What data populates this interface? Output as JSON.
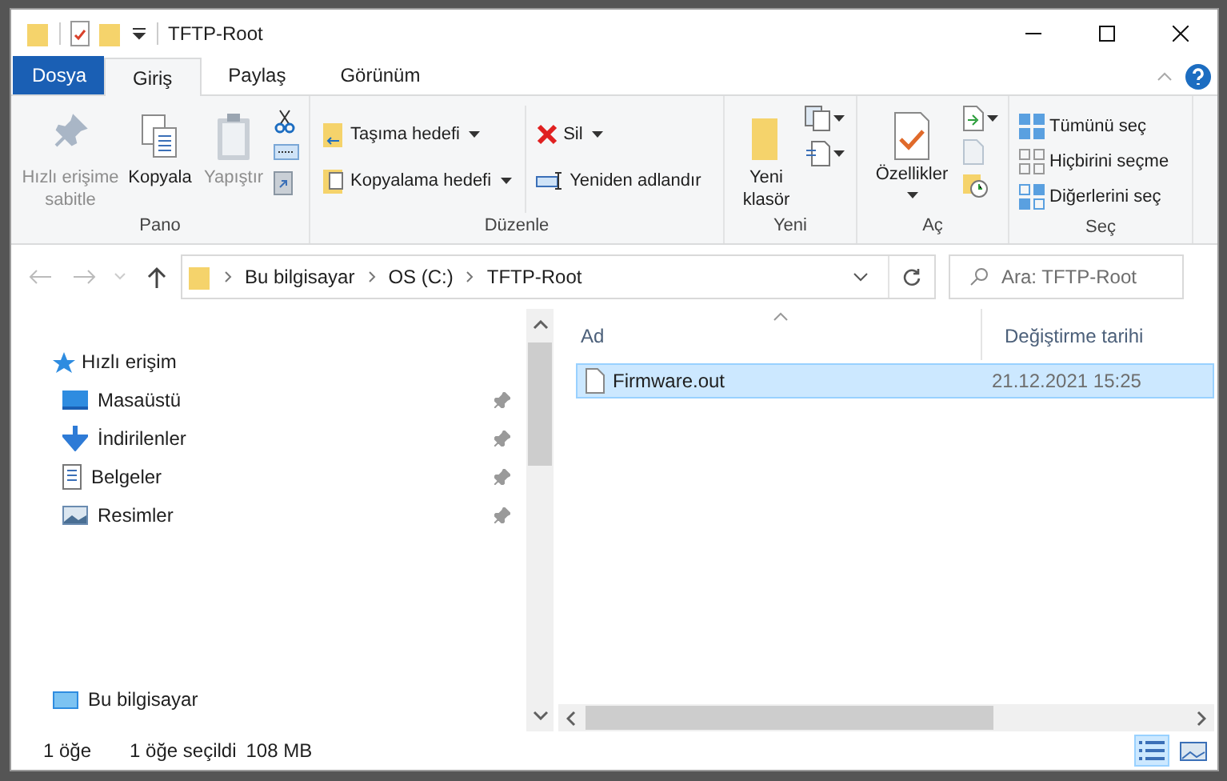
{
  "window": {
    "title": "TFTP-Root"
  },
  "ribbon": {
    "tabs": [
      {
        "label": "Dosya",
        "kind": "file",
        "selected": false
      },
      {
        "label": "Giriş",
        "kind": "tab",
        "selected": true
      },
      {
        "label": "Paylaş",
        "kind": "tab",
        "selected": false
      },
      {
        "label": "Görünüm",
        "kind": "tab",
        "selected": false
      }
    ],
    "groups": [
      {
        "label": "Pano",
        "items": [
          {
            "label": "Hızlı erişime sabitle",
            "disabled": true
          },
          {
            "label": "Kopyala",
            "disabled": false
          },
          {
            "label": "Yapıştır",
            "disabled": true
          }
        ]
      },
      {
        "label": "Düzenle",
        "items": [
          {
            "label": "Taşıma hedefi",
            "disabled": false
          },
          {
            "label": "Kopyalama hedefi",
            "disabled": false
          },
          {
            "label": "Sil",
            "disabled": false
          },
          {
            "label": "Yeniden adlandır",
            "disabled": false
          }
        ]
      },
      {
        "label": "Yeni",
        "items": [
          {
            "label": "Yeni klasör",
            "disabled": false
          }
        ]
      },
      {
        "label": "Aç",
        "items": [
          {
            "label": "Özellikler",
            "disabled": false
          }
        ]
      },
      {
        "label": "Seç",
        "items": [
          {
            "label": "Tümünü seç",
            "disabled": false
          },
          {
            "label": "Hiçbirini seçme",
            "disabled": false
          },
          {
            "label": "Diğerlerini seç",
            "disabled": false
          }
        ]
      }
    ]
  },
  "address": {
    "path": [
      "Bu bilgisayar",
      "OS (C:)",
      "TFTP-Root"
    ]
  },
  "search": {
    "placeholder": "Ara: TFTP-Root"
  },
  "navigation": [
    {
      "label": "Hızlı erişim",
      "children": [
        {
          "label": "Masaüstü",
          "pinned": true
        },
        {
          "label": "İndirilenler",
          "pinned": true
        },
        {
          "label": "Belgeler",
          "pinned": true
        },
        {
          "label": "Resimler",
          "pinned": true
        }
      ]
    },
    {
      "label": "Bu bilgisayar"
    }
  ],
  "files": {
    "columns": [
      "Ad",
      "Değiştirme tarihi"
    ],
    "rows": [
      {
        "name": "Firmware.out",
        "modified": "21.12.2021 15:25",
        "selected": true
      }
    ]
  },
  "status_bar": {
    "items": [
      "1 öğe",
      "1 öğe seçildi",
      "108 MB"
    ]
  },
  "view_buttons": [
    {
      "selected": true
    },
    {
      "selected": false
    }
  ]
}
